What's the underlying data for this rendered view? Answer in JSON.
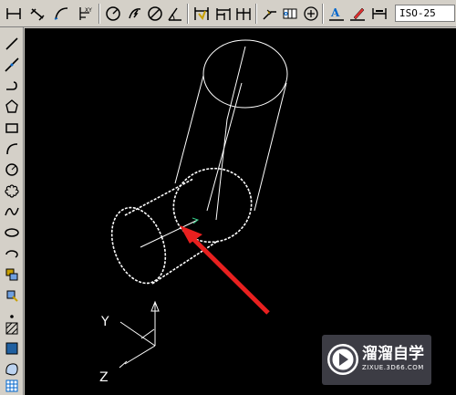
{
  "toolbar": {
    "dim_style_value": "ISO-25",
    "buttons": [
      "linear-dim-icon",
      "aligned-dim-icon",
      "arc-length-icon",
      "ordinate-dim-icon",
      "radius-dim-icon",
      "jogged-dim-icon",
      "diameter-dim-icon",
      "angular-dim-icon",
      "quick-dim-icon",
      "baseline-dim-icon",
      "continue-dim-icon",
      "leader-icon",
      "tolerance-icon",
      "center-mark-icon",
      "dim-edit-icon",
      "dim-text-edit-icon",
      "dim-update-icon"
    ]
  },
  "left_toolbar": {
    "tools": [
      "line-icon",
      "construction-line-icon",
      "polyline-icon",
      "polygon-icon",
      "rectangle-icon",
      "arc-icon",
      "circle-icon",
      "revision-cloud-icon",
      "spline-icon",
      "ellipse-icon",
      "ellipse-arc-icon",
      "insert-block-icon",
      "make-block-icon",
      "point-icon",
      "hatch-icon",
      "gradient-icon",
      "region-icon",
      "table-icon"
    ]
  },
  "canvas": {
    "background": "#000000",
    "line_color": "#ffffff",
    "ucs_labels": {
      "y": "Y",
      "z": "Z"
    },
    "arrow_color": "#e8201f"
  },
  "watermark": {
    "title": "溜溜自学",
    "subtitle": "ZIXUE.3D66.COM"
  }
}
